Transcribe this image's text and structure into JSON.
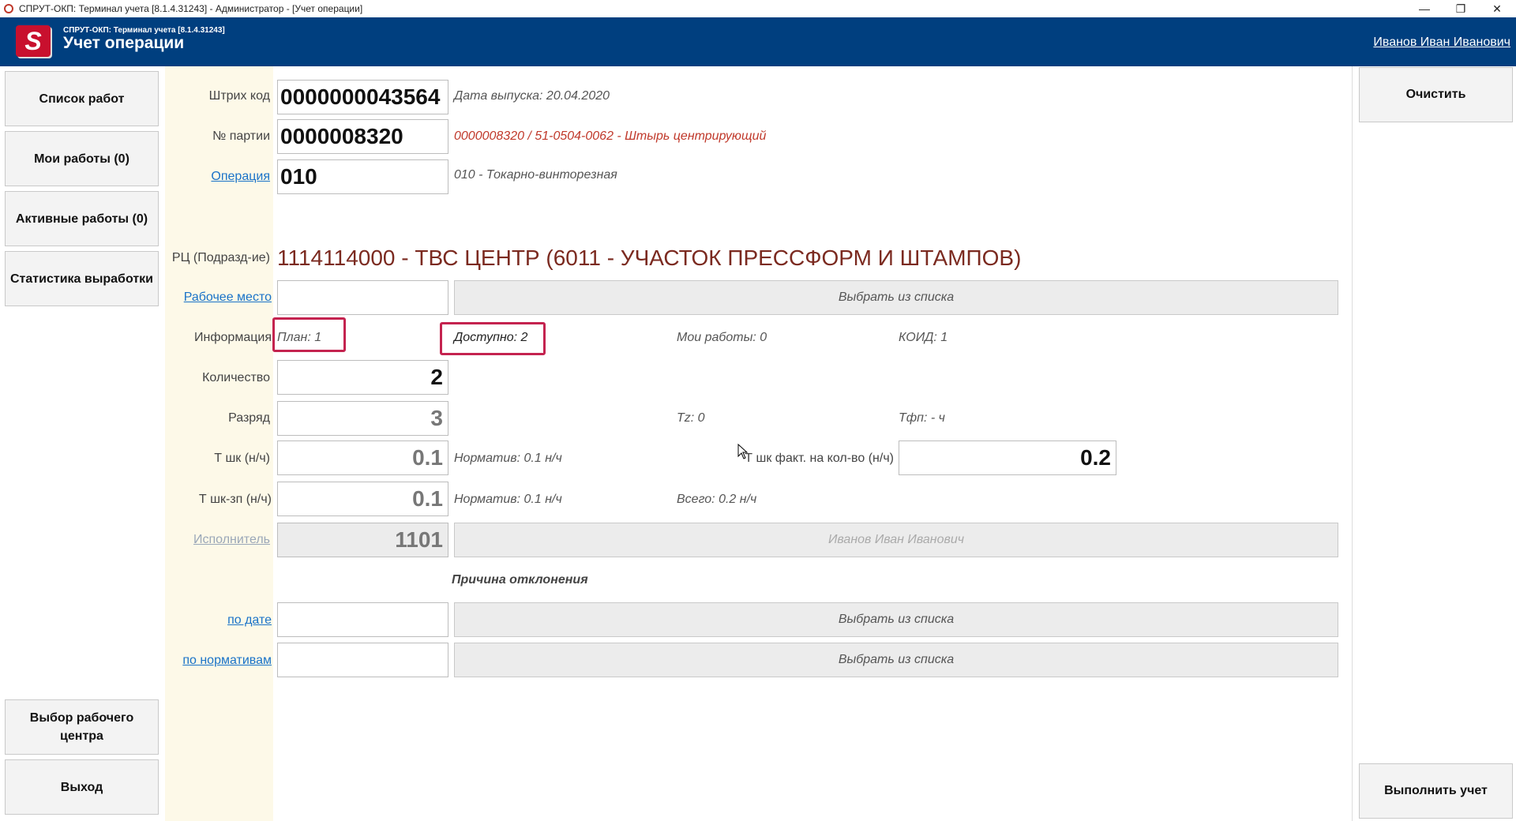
{
  "window": {
    "title": "СПРУТ-ОКП: Терминал учета [8.1.4.31243] - Администратор - [Учет операции]",
    "minimize": "—",
    "maximize": "❐",
    "close": "✕"
  },
  "header": {
    "logo_letter": "S",
    "subtitle": "СПРУТ-ОКП: Терминал учета [8.1.4.31243]",
    "title": "Учет операции",
    "user": "Иванов Иван Иванович",
    "bg_color": "#003f7f"
  },
  "nav": {
    "work_list": "Список работ",
    "my_work": "Мои работы (0)",
    "active_work": "Активные работы (0)",
    "stats": "Статистика выработки",
    "choose_center": "Выбор рабочего центра",
    "exit": "Выход"
  },
  "right": {
    "clear": "Очистить",
    "execute": "Выполнить учет"
  },
  "form": {
    "barcode": {
      "label": "Штрих код",
      "value": "0000000043564",
      "info": "Дата выпуска: 20.04.2020"
    },
    "batch": {
      "label": "№ партии",
      "value": "0000008320",
      "info": "0000008320 / 51-0504-0062 - Штырь центрирующий"
    },
    "operation": {
      "label": "Операция",
      "value": "010",
      "info": "010 - Токарно-винторезная"
    },
    "workcenter": {
      "label": "РЦ (Подразд-ие)",
      "value": "1114114000 - ТВС ЦЕНТР (6011 - УЧАСТОК ПРЕССФОРМ И ШТАМПОВ)"
    },
    "workplace": {
      "label": "Рабочее место",
      "value": "",
      "button": "Выбрать из списка"
    },
    "info": {
      "label": "Информация",
      "plan": "План: 1",
      "available": "Доступно: 2",
      "my_works": "Мои работы: 0",
      "koid": "КОИД: 1"
    },
    "quantity": {
      "label": "Количество",
      "value": "2"
    },
    "grade": {
      "label": "Разряд",
      "value": "3",
      "tz": "Тz: 0",
      "tfp": "Тфп:  -  ч"
    },
    "tsk": {
      "label": "Т шк (н/ч)",
      "value": "0.1",
      "norm": "Норматив: 0.1 н/ч",
      "fact_label": "Т шк факт. на кол-во (н/ч)",
      "fact_value": "0.2"
    },
    "tsk_zp": {
      "label": "Т шк-зп (н/ч)",
      "value": "0.1",
      "norm": "Норматив: 0.1 н/ч",
      "total": "Всего: 0.2 н/ч"
    },
    "executor": {
      "label": "Исполнитель",
      "value": "1101",
      "name": "Иванов Иван Иванович"
    },
    "deviation": {
      "title": "Причина отклонения",
      "by_date": {
        "label": "по дате",
        "value": "",
        "button": "Выбрать из списка"
      },
      "by_norms": {
        "label": "по нормативам",
        "value": "",
        "button": "Выбрать из списка"
      }
    }
  },
  "colors": {
    "highlight": "#c4234f",
    "accent_red": "#c0392b",
    "workcenter_text": "#7b2a20",
    "left_strip": "#fdf9e8"
  }
}
